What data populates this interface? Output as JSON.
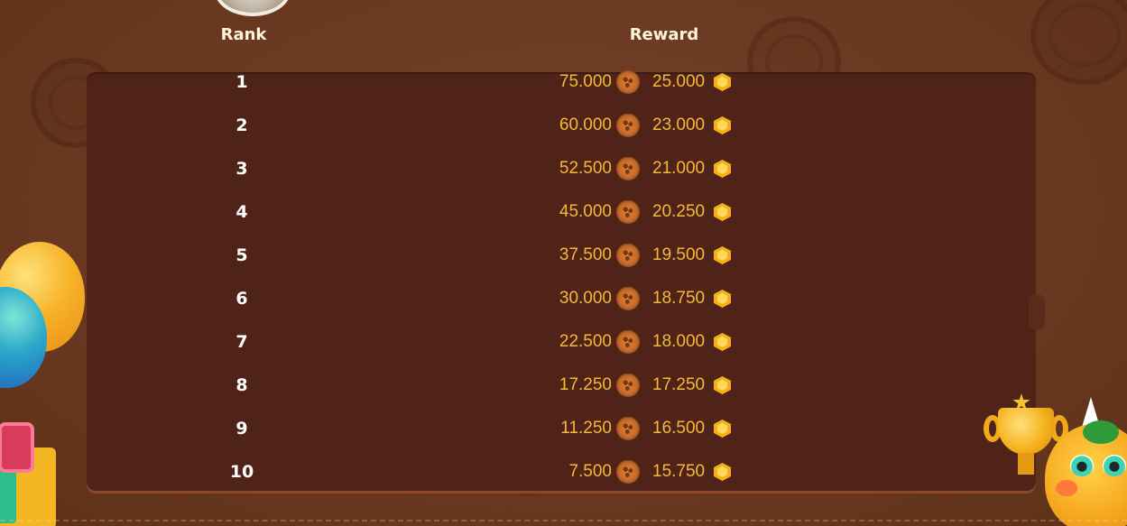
{
  "header": {
    "rank_label": "Rank",
    "reward_label": "Reward"
  },
  "rewards": [
    {
      "rank": "1",
      "cookies": "75.000",
      "coins": "25.000"
    },
    {
      "rank": "2",
      "cookies": "60.000",
      "coins": "23.000"
    },
    {
      "rank": "3",
      "cookies": "52.500",
      "coins": "21.000"
    },
    {
      "rank": "4",
      "cookies": "45.000",
      "coins": "20.250"
    },
    {
      "rank": "5",
      "cookies": "37.500",
      "coins": "19.500"
    },
    {
      "rank": "6",
      "cookies": "30.000",
      "coins": "18.750"
    },
    {
      "rank": "7",
      "cookies": "22.500",
      "coins": "18.000"
    },
    {
      "rank": "8",
      "cookies": "17.250",
      "coins": "17.250"
    },
    {
      "rank": "9",
      "cookies": "11.250",
      "coins": "16.500"
    },
    {
      "rank": "10",
      "cookies": "7.500",
      "coins": "15.750"
    }
  ],
  "icons": {
    "reward_1": "cookie-icon",
    "reward_2": "coin-icon"
  },
  "colors": {
    "background": "#6b3a22",
    "panel": "#4f2318",
    "rank_text": "#ffffff",
    "reward_text": "#f5b83a",
    "header_text": "#fff4dc"
  }
}
